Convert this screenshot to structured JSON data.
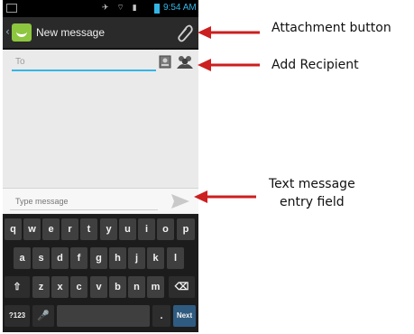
{
  "status_bar": {
    "time": "9:54 AM"
  },
  "action_bar": {
    "title": "New message"
  },
  "recipient": {
    "placeholder": "To"
  },
  "compose": {
    "placeholder": "Type message"
  },
  "keyboard": {
    "row1": [
      "q",
      "w",
      "e",
      "r",
      "t",
      "y",
      "u",
      "i",
      "o",
      "p"
    ],
    "row2": [
      "a",
      "s",
      "d",
      "f",
      "g",
      "h",
      "j",
      "k",
      "l"
    ],
    "row3": [
      "z",
      "x",
      "c",
      "v",
      "b",
      "n",
      "m"
    ],
    "shift": "⇧",
    "delete": "⌫",
    "symbols": "?123",
    "mic": "🎤",
    "period": ".",
    "next": "Next"
  },
  "annotations": {
    "attachment": "Attachment button",
    "recipient": "Add Recipient",
    "text_entry_line1": "Text message",
    "text_entry_line2": "entry field"
  },
  "colors": {
    "accent": "#33b5e5",
    "annotation_arrow": "#cc1f1f",
    "action_bar": "#2a2a2a"
  }
}
